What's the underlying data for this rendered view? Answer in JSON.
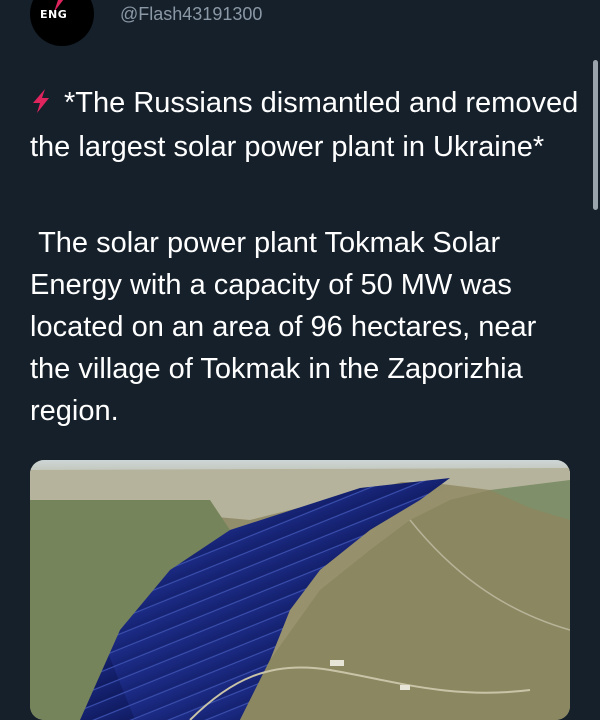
{
  "tweet": {
    "avatar_badge": "ENG",
    "handle": "@Flash43191300",
    "icon": "lightning-bolt-icon",
    "text_headline": "*The Russians dismantled and removed the largest solar power plant in Ukraine*",
    "text_body": " The solar power plant Tokmak Solar Energy with a capacity of 50 MW was located on an area of 96 hectares, near the village of Tokmak in the Zaporizhia region.",
    "media": "aerial-solar-plant-photo"
  },
  "colors": {
    "background": "#15202b",
    "handle": "#8b98a5",
    "lightning": "#e0245e",
    "avatar_bolt": "#e0245e"
  }
}
